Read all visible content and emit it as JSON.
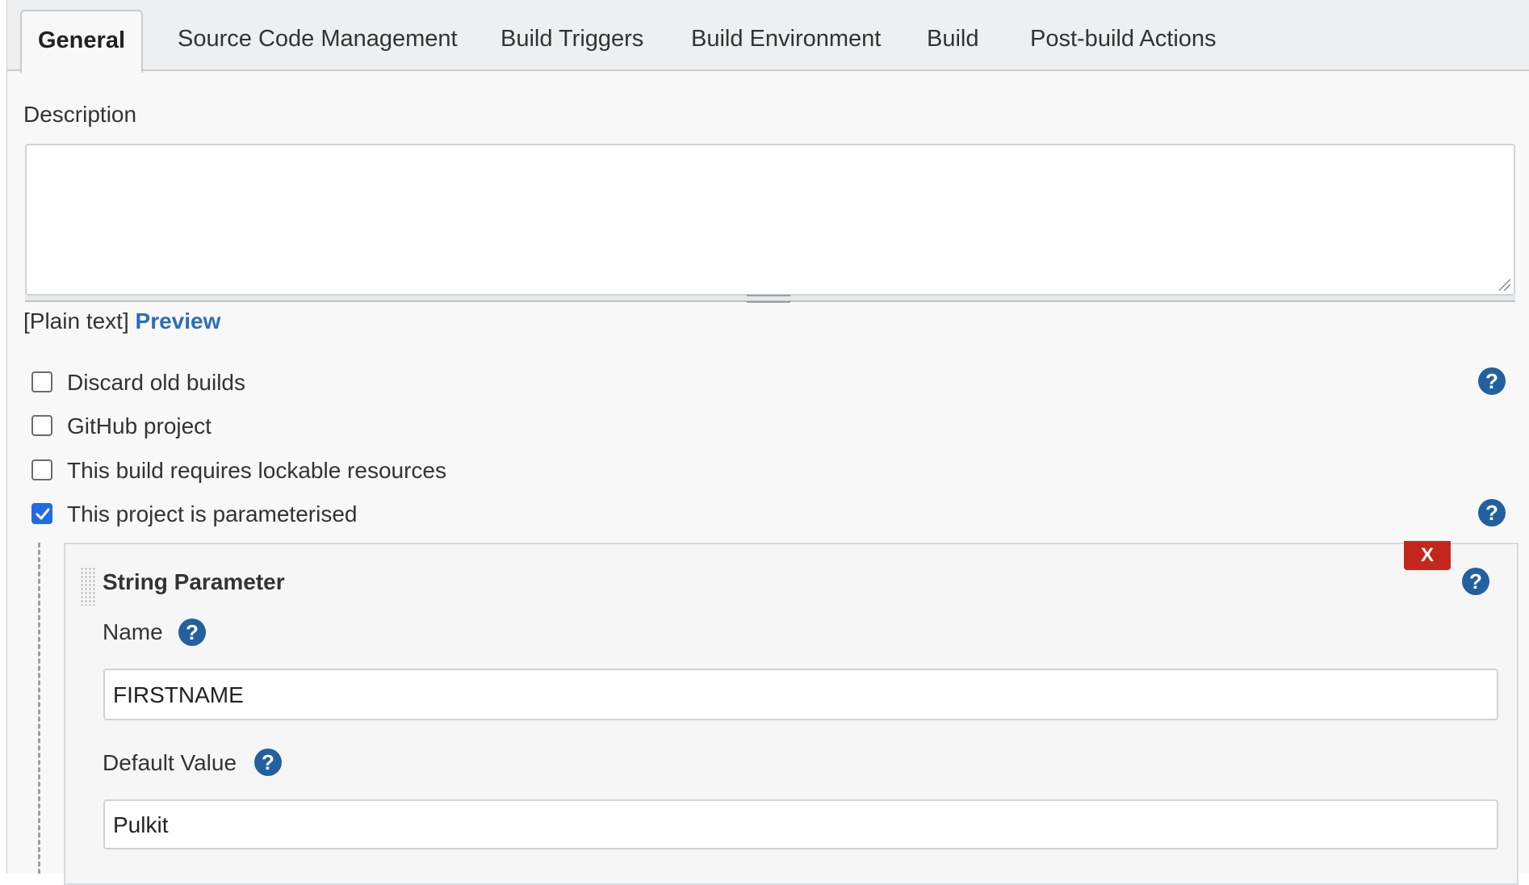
{
  "tabs": [
    {
      "label": "General",
      "active": true
    },
    {
      "label": "Source Code Management"
    },
    {
      "label": "Build Triggers"
    },
    {
      "label": "Build Environment"
    },
    {
      "label": "Build"
    },
    {
      "label": "Post-build Actions"
    }
  ],
  "description": {
    "label": "Description",
    "value": "",
    "format_prefix": "[Plain text]",
    "preview_link": "Preview"
  },
  "options": [
    {
      "label": "Discard old builds",
      "checked": false
    },
    {
      "label": "GitHub project",
      "checked": false
    },
    {
      "label": "This build requires lockable resources",
      "checked": false
    },
    {
      "label": "This project is parameterised",
      "checked": true
    }
  ],
  "parameter": {
    "title": "String Parameter",
    "delete_label": "X",
    "name_label": "Name",
    "name_value": "FIRSTNAME",
    "default_label": "Default Value",
    "default_value": "Pulkit"
  },
  "help_glyph": "?",
  "colors": {
    "accent": "#2a6ebb",
    "help": "#23609f",
    "delete": "#c4261d",
    "checkbox_checked": "#1f6ae6"
  }
}
